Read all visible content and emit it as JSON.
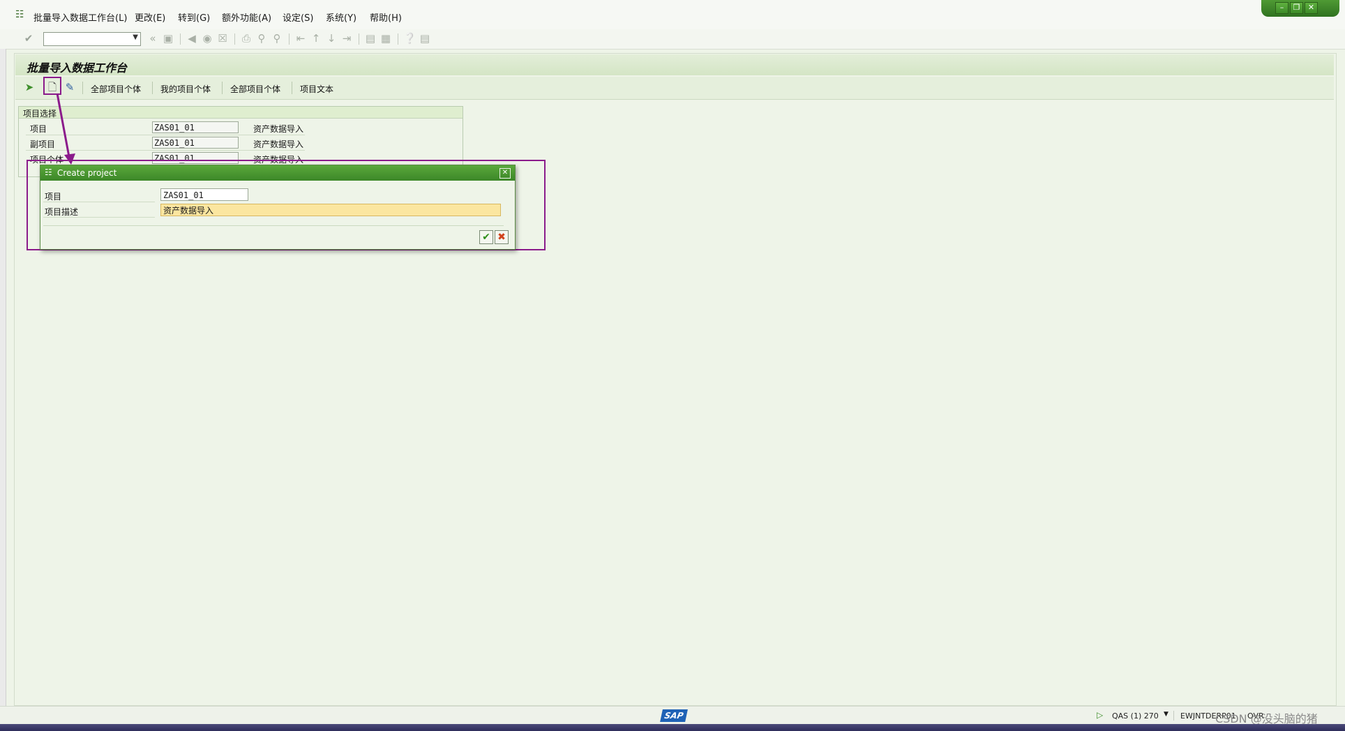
{
  "menubar": {
    "items": [
      "批量导入数据工作台(L)",
      "更改(E)",
      "转到(G)",
      "额外功能(A)",
      "设定(S)",
      "系统(Y)",
      "帮助(H)"
    ]
  },
  "screen": {
    "title": "批量导入数据工作台"
  },
  "app_toolbar": {
    "buttons": [
      "全部项目个体",
      "我的项目个体",
      "全部项目个体",
      "项目文本"
    ]
  },
  "selection": {
    "title": "项目选择",
    "rows": [
      {
        "label": "项目",
        "value": "ZAS01_01",
        "desc": "资产数据导入"
      },
      {
        "label": "副项目",
        "value": "ZAS01_01",
        "desc": "资产数据导入"
      },
      {
        "label": "项目个体",
        "value": "ZAS01_01",
        "desc": "资产数据导入"
      }
    ]
  },
  "dialog": {
    "title": "Create project",
    "fields": [
      {
        "label": "项目",
        "value": "ZAS01_01"
      },
      {
        "label": "项目描述",
        "value": "资产数据导入"
      }
    ]
  },
  "statusbar": {
    "system": "QAS (1) 270",
    "server": "EWJNTDERP01",
    "mode": "OVR",
    "watermark": "CSDN @没头脑的猪"
  },
  "colors": {
    "accent_green": "#3c8728",
    "annotation_purple": "#8b1b8b",
    "required_field": "#fbe6a0"
  },
  "icons": {
    "window_controls": [
      "minimize-icon",
      "restore-icon",
      "close-icon"
    ],
    "create": "create-document-icon",
    "change": "edit-icon",
    "execute": "execute-icon"
  }
}
